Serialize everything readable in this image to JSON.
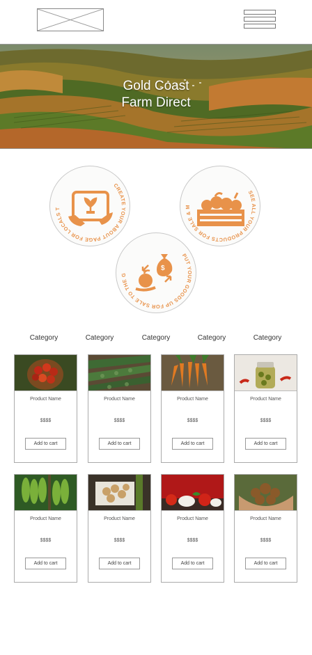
{
  "hero": {
    "title_line1": "Gold Coast",
    "title_line2": "Farm Direct"
  },
  "menu": {
    "icon": "hamburger-menu-icon"
  },
  "badges": [
    {
      "text": "CREATE YOUR ABOUT PAGE FOR LOCALS TO GET TO KNOW YOU",
      "icon": "tablet-sprout-icon"
    },
    {
      "text": "SEE ALL YOUR PRODUCTS FOR SALE & MAKE UPDATES",
      "icon": "produce-crate-icon"
    },
    {
      "text": "PUT YOUR GOODS UP FOR SALE TO THE GENERAL PUBLIC!",
      "icon": "money-exchange-icon"
    }
  ],
  "categories": [
    "Category",
    "Category",
    "Category",
    "Category",
    "Category"
  ],
  "products": [
    {
      "name": "Product Name",
      "price": "$$$$",
      "button": "Add to cart",
      "image": "apples-basket"
    },
    {
      "name": "Product Name",
      "price": "$$$$",
      "button": "Add to cart",
      "image": "crop-rows"
    },
    {
      "name": "Product Name",
      "price": "$$$$",
      "button": "Add to cart",
      "image": "carrots"
    },
    {
      "name": "Product Name",
      "price": "$$$$",
      "button": "Add to cart",
      "image": "pickled-jar"
    },
    {
      "name": "Product Name",
      "price": "$$$$",
      "button": "Add to cart",
      "image": "bananas"
    },
    {
      "name": "Product Name",
      "price": "$$$$",
      "button": "Add to cart",
      "image": "potatoes"
    },
    {
      "name": "Product Name",
      "price": "$$$$",
      "button": "Add to cart",
      "image": "tomatoes-mozzarella"
    },
    {
      "name": "Product Name",
      "price": "$$$$",
      "button": "Add to cart",
      "image": "potatoes-in-hands"
    }
  ],
  "colors": {
    "accent": "#e8924a",
    "badge_bg": "#fbfbfa"
  }
}
